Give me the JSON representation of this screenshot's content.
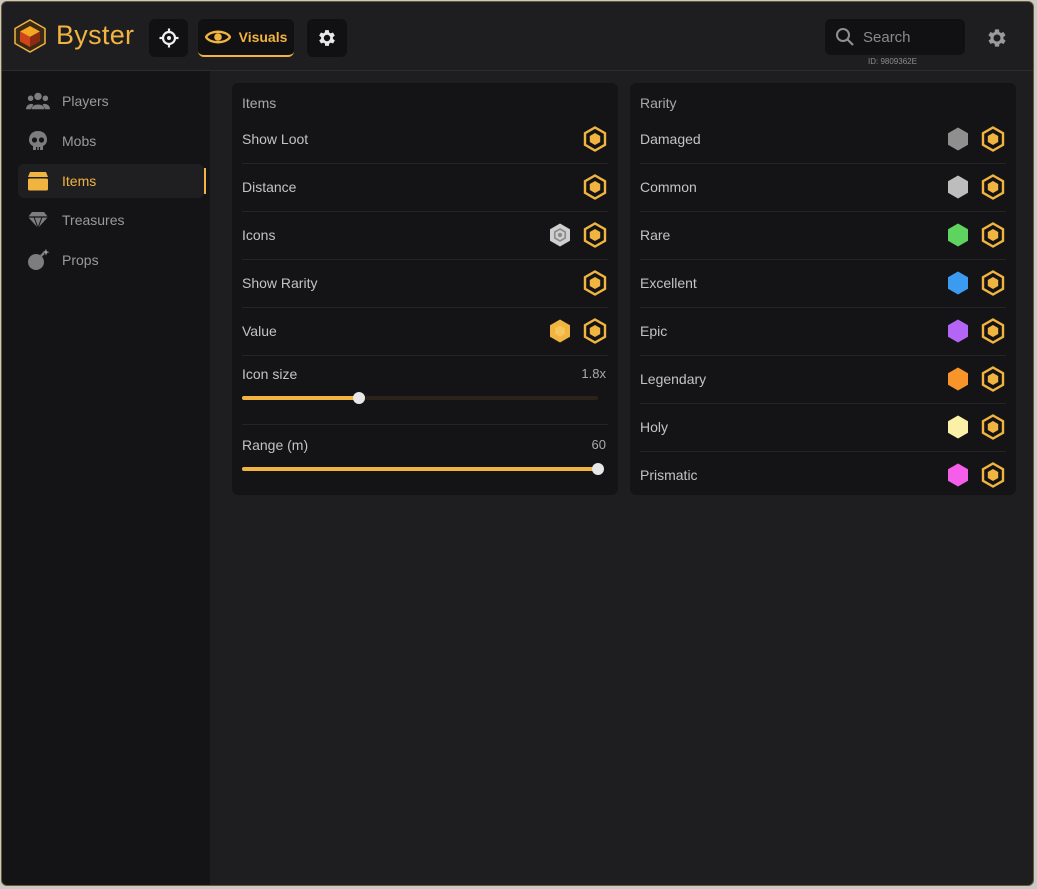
{
  "app": {
    "name": "Byster",
    "accent": "#f2b441"
  },
  "toolbar": {
    "tabs": [
      {
        "icon": "crosshair-icon",
        "label": ""
      },
      {
        "icon": "eye-icon",
        "label": "Visuals"
      },
      {
        "icon": "gear-icon",
        "label": ""
      }
    ],
    "search_placeholder": "Search",
    "id_text": "ID: 9809362E"
  },
  "sidebar": {
    "items": [
      {
        "label": "Players",
        "icon": "users-icon",
        "active": false
      },
      {
        "label": "Mobs",
        "icon": "skull-icon",
        "active": false
      },
      {
        "label": "Items",
        "icon": "box-icon",
        "active": true
      },
      {
        "label": "Treasures",
        "icon": "gem-icon",
        "active": false
      },
      {
        "label": "Props",
        "icon": "bomb-icon",
        "active": false
      }
    ]
  },
  "items_panel": {
    "title": "Items",
    "rows": [
      {
        "label": "Show Loot"
      },
      {
        "label": "Distance"
      },
      {
        "label": "Icons",
        "swatch": "#cfcfcf"
      },
      {
        "label": "Show Rarity"
      },
      {
        "label": "Value",
        "swatch": "#f2b441"
      }
    ],
    "sliders": [
      {
        "label": "Icon size",
        "value_text": "1.8x",
        "fraction": 0.33
      },
      {
        "label": "Range (m)",
        "value_text": "60",
        "fraction": 1.0
      }
    ]
  },
  "rarity_panel": {
    "title": "Rarity",
    "rows": [
      {
        "label": "Damaged",
        "color": "#8f8f8f"
      },
      {
        "label": "Common",
        "color": "#bdbdbd"
      },
      {
        "label": "Rare",
        "color": "#5fd35f"
      },
      {
        "label": "Excellent",
        "color": "#3b9bf0"
      },
      {
        "label": "Epic",
        "color": "#b565f5"
      },
      {
        "label": "Legendary",
        "color": "#f7952a"
      },
      {
        "label": "Holy",
        "color": "#fbf0a8"
      },
      {
        "label": "Prismatic",
        "color": "#f45ee8"
      }
    ]
  }
}
